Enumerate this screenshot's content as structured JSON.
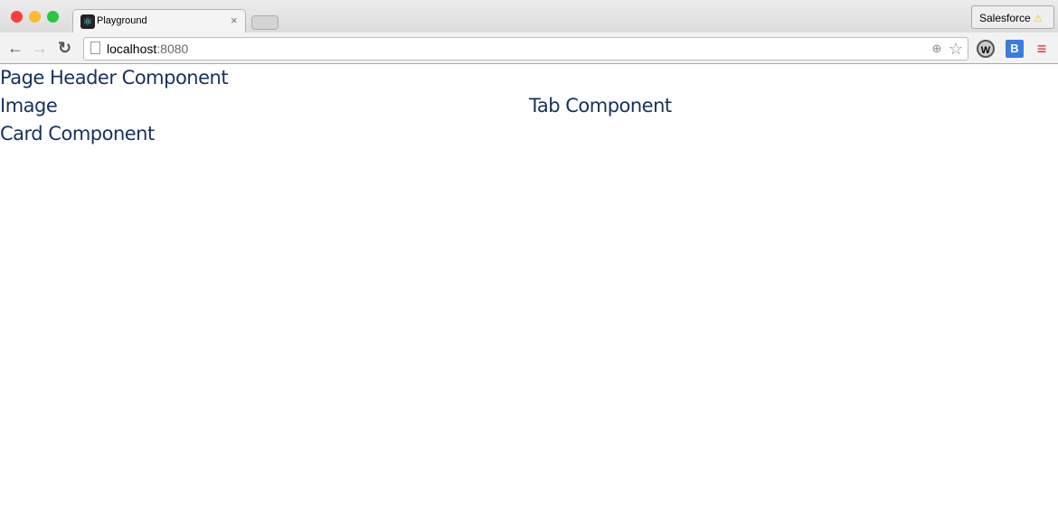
{
  "browser": {
    "tab_title": "Playground",
    "url_host": "localhost",
    "url_port": ":8080",
    "profile_button": "Salesforce"
  },
  "content": {
    "items": [
      "Page Header Component",
      "Image",
      "Tab Component",
      "Card Component"
    ]
  },
  "colors": {
    "text": "#16325c"
  }
}
